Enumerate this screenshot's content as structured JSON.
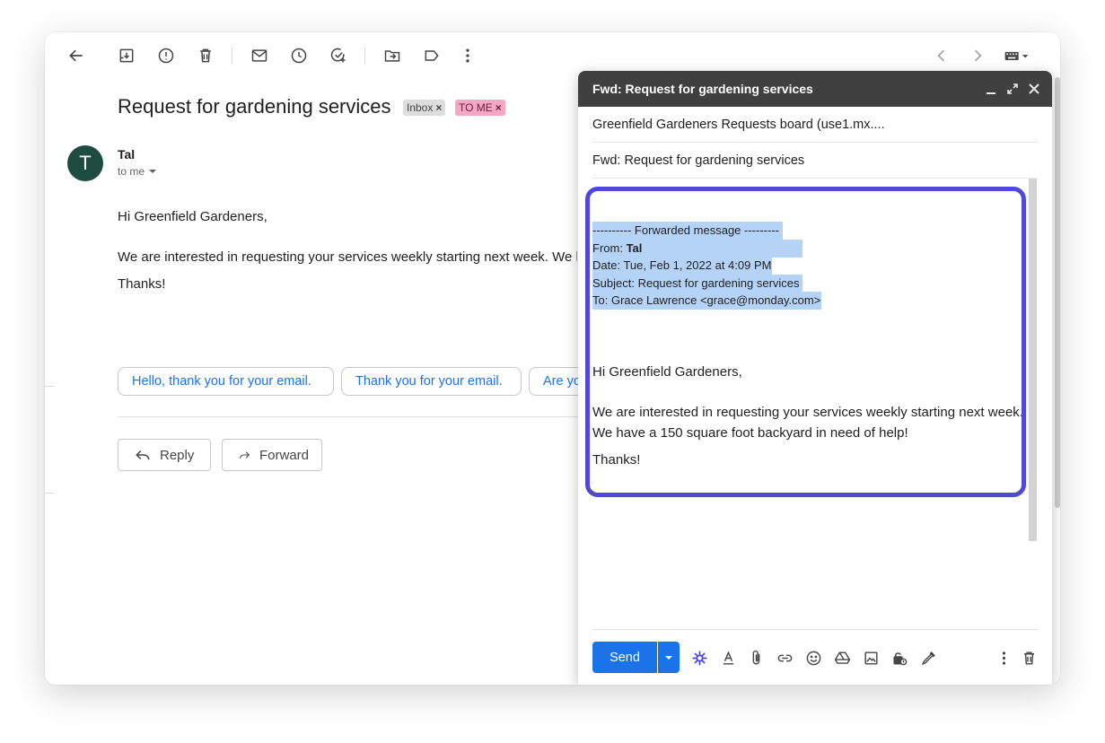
{
  "email": {
    "subject": "Request for gardening services",
    "labels": [
      {
        "text": "Inbox",
        "close": "×"
      },
      {
        "text": "TO ME",
        "close": "×"
      }
    ],
    "sender_initial": "T",
    "sender_name": "Tal",
    "recipient_line": "to me",
    "body": [
      "Hi Greenfield Gardeners,",
      "We are interested in requesting your services weekly starting next week. We h",
      "Thanks!"
    ],
    "smart_replies": [
      "Hello, thank you for your email.",
      "Thank you for your email.",
      "Are yo"
    ],
    "reply_label": "Reply",
    "forward_label": "Forward"
  },
  "compose": {
    "title": "Fwd: Request for gardening services",
    "to": "Greenfield Gardeners Requests board (use1.mx....",
    "subject": "Fwd: Request for gardening services",
    "forwarded": {
      "header": "---------- Forwarded message ---------",
      "from_label": "From: ",
      "from_name": "Tal",
      "date": "Date: Tue, Feb 1, 2022 at 4:09 PM",
      "subject": "Subject: Request for gardening services",
      "to": "To: Grace Lawrence <grace@monday.com>"
    },
    "body": [
      "Hi Greenfield Gardeners,",
      "We are interested in requesting your services weekly starting next week.",
      "We have a 150 square foot backyard in need of help!",
      "Thanks!"
    ],
    "send_label": "Send"
  },
  "colors": {
    "accent": "#1a73e8",
    "highlight_border": "#5048d6",
    "selection": "#b5d3f7",
    "avatar": "#1e4d3f",
    "compose_header": "#404040"
  }
}
